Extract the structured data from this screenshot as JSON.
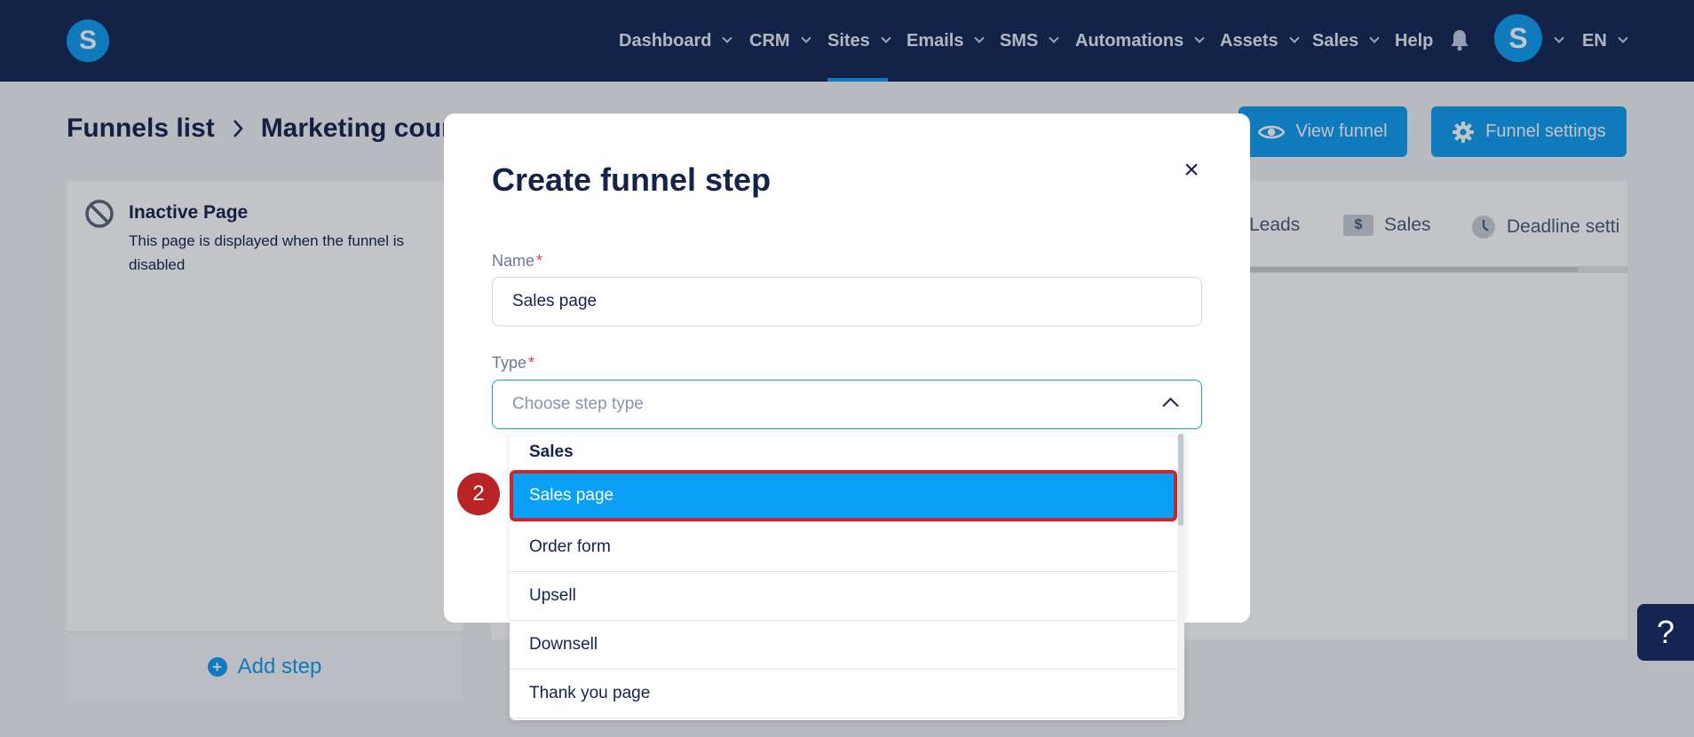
{
  "nav": {
    "logo_letter": "S",
    "items": [
      {
        "label": "Dashboard"
      },
      {
        "label": "CRM"
      },
      {
        "label": "Sites"
      },
      {
        "label": "Emails"
      },
      {
        "label": "SMS"
      },
      {
        "label": "Automations"
      },
      {
        "label": "Assets"
      },
      {
        "label": "Sales"
      },
      {
        "label": "Help"
      }
    ],
    "active_item": "Sites",
    "avatar_letter": "S",
    "language": "EN"
  },
  "breadcrumb": {
    "items": [
      "Funnels list",
      "Marketing cour"
    ]
  },
  "header_buttons": {
    "view_funnel": "View funnel",
    "funnel_settings": "Funnel settings"
  },
  "inactive_page": {
    "title": "Inactive Page",
    "description": "This page is displayed when the funnel is disabled"
  },
  "add_step": {
    "label": "Add step"
  },
  "tabs": {
    "leads": "Leads",
    "sales": "Sales",
    "sales_icon": "$",
    "deadline": "Deadline setti"
  },
  "modal": {
    "title": "Create funnel step",
    "close_icon": "×",
    "name_field": {
      "label": "Name",
      "required_mark": "*",
      "value": "Sales page"
    },
    "type_field": {
      "label": "Type",
      "required_mark": "*",
      "placeholder": "Choose step type"
    }
  },
  "dropdown": {
    "group_label": "Sales",
    "options": [
      "Sales page",
      "Order form",
      "Upsell",
      "Downsell",
      "Thank you page"
    ],
    "selected": "Sales page"
  },
  "annotation": {
    "step_number": "2"
  },
  "help_widget": {
    "symbol": "?"
  },
  "colors": {
    "nav_bg": "#142553",
    "accent": "#0e9bf0",
    "highlight_border": "#c8282d",
    "marker": "#b82326"
  }
}
